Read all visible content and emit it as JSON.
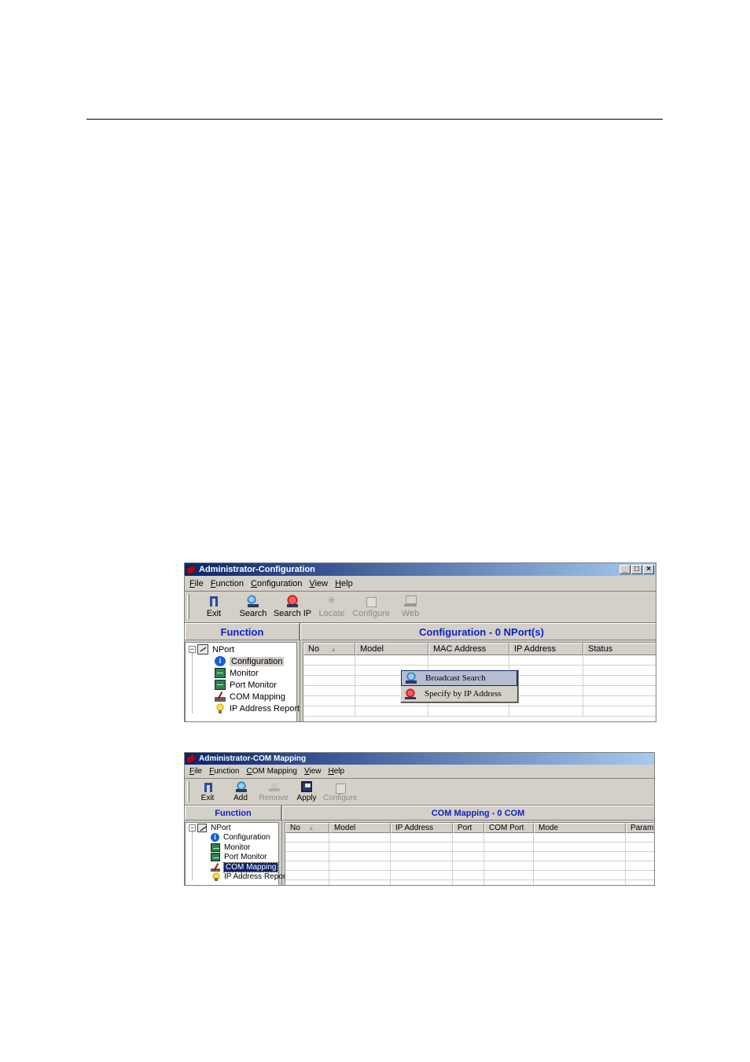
{
  "win1": {
    "title": "Administrator-Configuration",
    "menu": [
      "File",
      "Function",
      "Configuration",
      "View",
      "Help"
    ],
    "toolbar": [
      {
        "label": "Exit",
        "icon": "exit-icon",
        "enabled": true
      },
      {
        "label": "Search",
        "icon": "search-icon",
        "enabled": true
      },
      {
        "label": "Search IP",
        "icon": "search-ip-icon",
        "enabled": true
      },
      {
        "label": "Locate",
        "icon": "locate-icon",
        "enabled": false
      },
      {
        "label": "Configure",
        "icon": "configure-icon",
        "enabled": false
      },
      {
        "label": "Web",
        "icon": "web-icon",
        "enabled": false
      }
    ],
    "left_header": "Function",
    "right_header": "Configuration - 0 NPort(s)",
    "tree": {
      "root": "NPort",
      "items": [
        "Configuration",
        "Monitor",
        "Port Monitor",
        "COM Mapping",
        "IP Address Report"
      ],
      "selected": "Configuration"
    },
    "columns": [
      "No",
      "Model",
      "MAC Address",
      "IP Address",
      "Status"
    ],
    "context_menu": [
      "Broadcast Search",
      "Specify by IP Address"
    ]
  },
  "win2": {
    "title": "Administrator-COM Mapping",
    "menu": [
      "File",
      "Function",
      "COM Mapping",
      "View",
      "Help"
    ],
    "toolbar": [
      {
        "label": "Exit",
        "icon": "exit-icon",
        "enabled": true
      },
      {
        "label": "Add",
        "icon": "add-icon",
        "enabled": true
      },
      {
        "label": "Remove",
        "icon": "remove-icon",
        "enabled": false
      },
      {
        "label": "Apply",
        "icon": "apply-icon",
        "enabled": true
      },
      {
        "label": "Configure",
        "icon": "configure-icon",
        "enabled": false
      }
    ],
    "left_header": "Function",
    "right_header": "COM Mapping - 0 COM",
    "tree": {
      "root": "NPort",
      "items": [
        "Configuration",
        "Monitor",
        "Port Monitor",
        "COM Mapping",
        "IP Address Report"
      ],
      "selected": "COM Mapping"
    },
    "columns": [
      "No",
      "Model",
      "IP Address",
      "Port",
      "COM Port",
      "Mode",
      "Paramete"
    ]
  }
}
